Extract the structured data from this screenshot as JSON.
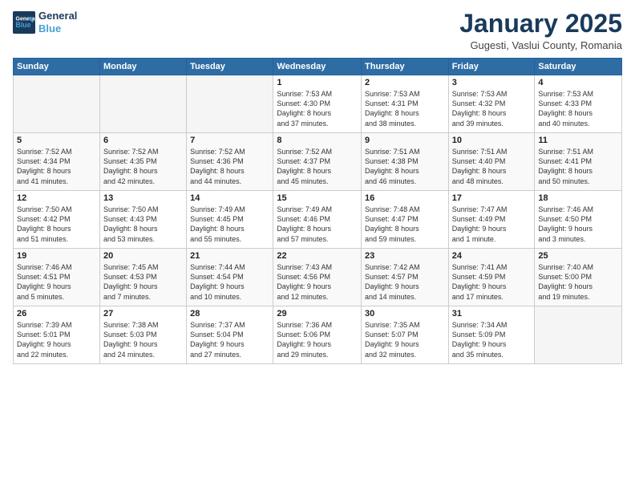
{
  "header": {
    "logo_line1": "General",
    "logo_line2": "Blue",
    "month": "January 2025",
    "location": "Gugesti, Vaslui County, Romania"
  },
  "weekdays": [
    "Sunday",
    "Monday",
    "Tuesday",
    "Wednesday",
    "Thursday",
    "Friday",
    "Saturday"
  ],
  "weeks": [
    [
      {
        "day": "",
        "info": ""
      },
      {
        "day": "",
        "info": ""
      },
      {
        "day": "",
        "info": ""
      },
      {
        "day": "1",
        "info": "Sunrise: 7:53 AM\nSunset: 4:30 PM\nDaylight: 8 hours\nand 37 minutes."
      },
      {
        "day": "2",
        "info": "Sunrise: 7:53 AM\nSunset: 4:31 PM\nDaylight: 8 hours\nand 38 minutes."
      },
      {
        "day": "3",
        "info": "Sunrise: 7:53 AM\nSunset: 4:32 PM\nDaylight: 8 hours\nand 39 minutes."
      },
      {
        "day": "4",
        "info": "Sunrise: 7:53 AM\nSunset: 4:33 PM\nDaylight: 8 hours\nand 40 minutes."
      }
    ],
    [
      {
        "day": "5",
        "info": "Sunrise: 7:52 AM\nSunset: 4:34 PM\nDaylight: 8 hours\nand 41 minutes."
      },
      {
        "day": "6",
        "info": "Sunrise: 7:52 AM\nSunset: 4:35 PM\nDaylight: 8 hours\nand 42 minutes."
      },
      {
        "day": "7",
        "info": "Sunrise: 7:52 AM\nSunset: 4:36 PM\nDaylight: 8 hours\nand 44 minutes."
      },
      {
        "day": "8",
        "info": "Sunrise: 7:52 AM\nSunset: 4:37 PM\nDaylight: 8 hours\nand 45 minutes."
      },
      {
        "day": "9",
        "info": "Sunrise: 7:51 AM\nSunset: 4:38 PM\nDaylight: 8 hours\nand 46 minutes."
      },
      {
        "day": "10",
        "info": "Sunrise: 7:51 AM\nSunset: 4:40 PM\nDaylight: 8 hours\nand 48 minutes."
      },
      {
        "day": "11",
        "info": "Sunrise: 7:51 AM\nSunset: 4:41 PM\nDaylight: 8 hours\nand 50 minutes."
      }
    ],
    [
      {
        "day": "12",
        "info": "Sunrise: 7:50 AM\nSunset: 4:42 PM\nDaylight: 8 hours\nand 51 minutes."
      },
      {
        "day": "13",
        "info": "Sunrise: 7:50 AM\nSunset: 4:43 PM\nDaylight: 8 hours\nand 53 minutes."
      },
      {
        "day": "14",
        "info": "Sunrise: 7:49 AM\nSunset: 4:45 PM\nDaylight: 8 hours\nand 55 minutes."
      },
      {
        "day": "15",
        "info": "Sunrise: 7:49 AM\nSunset: 4:46 PM\nDaylight: 8 hours\nand 57 minutes."
      },
      {
        "day": "16",
        "info": "Sunrise: 7:48 AM\nSunset: 4:47 PM\nDaylight: 8 hours\nand 59 minutes."
      },
      {
        "day": "17",
        "info": "Sunrise: 7:47 AM\nSunset: 4:49 PM\nDaylight: 9 hours\nand 1 minute."
      },
      {
        "day": "18",
        "info": "Sunrise: 7:46 AM\nSunset: 4:50 PM\nDaylight: 9 hours\nand 3 minutes."
      }
    ],
    [
      {
        "day": "19",
        "info": "Sunrise: 7:46 AM\nSunset: 4:51 PM\nDaylight: 9 hours\nand 5 minutes."
      },
      {
        "day": "20",
        "info": "Sunrise: 7:45 AM\nSunset: 4:53 PM\nDaylight: 9 hours\nand 7 minutes."
      },
      {
        "day": "21",
        "info": "Sunrise: 7:44 AM\nSunset: 4:54 PM\nDaylight: 9 hours\nand 10 minutes."
      },
      {
        "day": "22",
        "info": "Sunrise: 7:43 AM\nSunset: 4:56 PM\nDaylight: 9 hours\nand 12 minutes."
      },
      {
        "day": "23",
        "info": "Sunrise: 7:42 AM\nSunset: 4:57 PM\nDaylight: 9 hours\nand 14 minutes."
      },
      {
        "day": "24",
        "info": "Sunrise: 7:41 AM\nSunset: 4:59 PM\nDaylight: 9 hours\nand 17 minutes."
      },
      {
        "day": "25",
        "info": "Sunrise: 7:40 AM\nSunset: 5:00 PM\nDaylight: 9 hours\nand 19 minutes."
      }
    ],
    [
      {
        "day": "26",
        "info": "Sunrise: 7:39 AM\nSunset: 5:01 PM\nDaylight: 9 hours\nand 22 minutes."
      },
      {
        "day": "27",
        "info": "Sunrise: 7:38 AM\nSunset: 5:03 PM\nDaylight: 9 hours\nand 24 minutes."
      },
      {
        "day": "28",
        "info": "Sunrise: 7:37 AM\nSunset: 5:04 PM\nDaylight: 9 hours\nand 27 minutes."
      },
      {
        "day": "29",
        "info": "Sunrise: 7:36 AM\nSunset: 5:06 PM\nDaylight: 9 hours\nand 29 minutes."
      },
      {
        "day": "30",
        "info": "Sunrise: 7:35 AM\nSunset: 5:07 PM\nDaylight: 9 hours\nand 32 minutes."
      },
      {
        "day": "31",
        "info": "Sunrise: 7:34 AM\nSunset: 5:09 PM\nDaylight: 9 hours\nand 35 minutes."
      },
      {
        "day": "",
        "info": ""
      }
    ]
  ]
}
